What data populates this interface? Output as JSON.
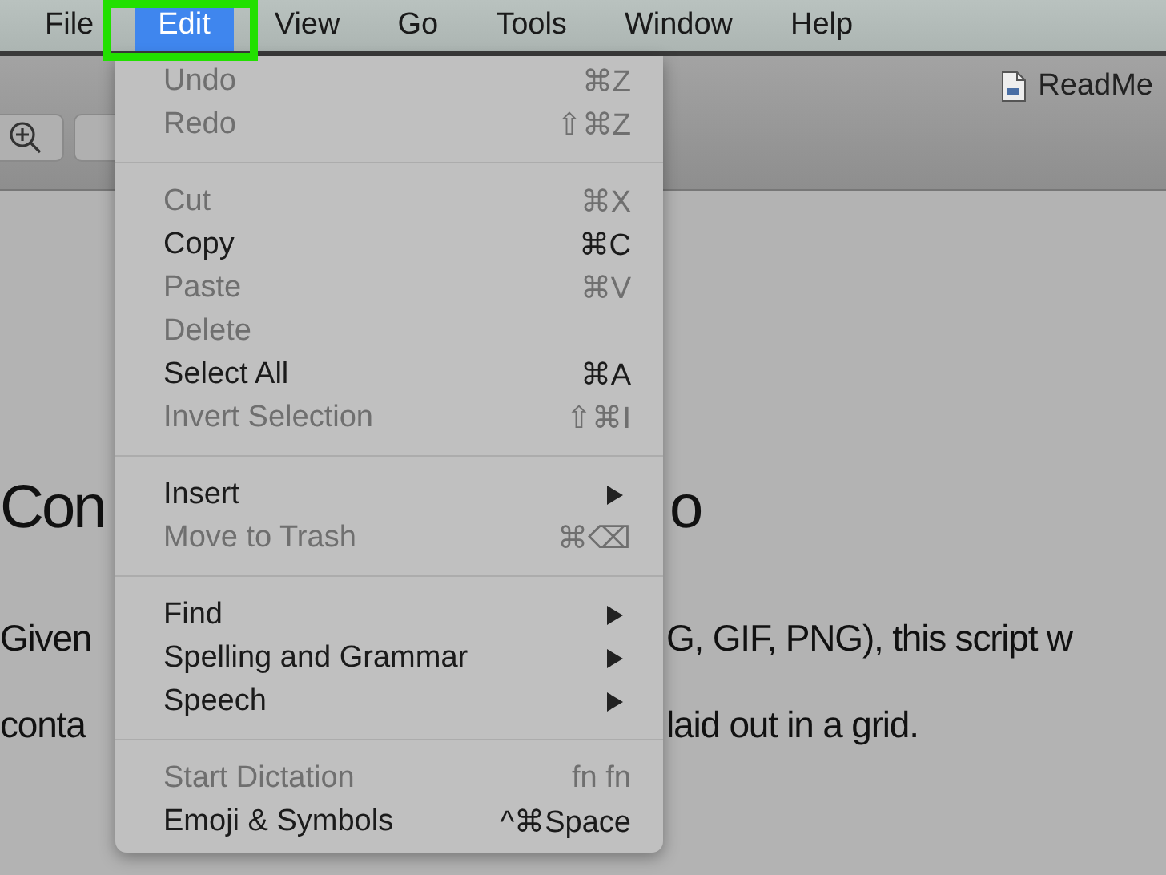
{
  "menu_bar": {
    "items": [
      {
        "label": "File",
        "selected": false,
        "outlined": false
      },
      {
        "label": "Edit",
        "selected": true,
        "outlined": true
      },
      {
        "label": "View",
        "selected": false,
        "outlined": false
      },
      {
        "label": "Go",
        "selected": false,
        "outlined": false
      },
      {
        "label": "Tools",
        "selected": false,
        "outlined": false
      },
      {
        "label": "Window",
        "selected": false,
        "outlined": false
      },
      {
        "label": "Help",
        "selected": false,
        "outlined": false
      }
    ]
  },
  "toolbar": {
    "document_title": "ReadMe"
  },
  "document": {
    "heading_parts": [
      "Con",
      "o"
    ],
    "lines": [
      [
        "Given",
        "G, GIF, PNG), this script w"
      ],
      [
        "conta",
        "laid out in a grid."
      ]
    ]
  },
  "edit_menu": {
    "groups": [
      [
        {
          "kind": "item",
          "label": "Undo",
          "shortcut": "⌘Z",
          "disabled": true
        },
        {
          "kind": "item",
          "label": "Redo",
          "shortcut": "⇧⌘Z",
          "disabled": true
        }
      ],
      [
        {
          "kind": "item",
          "label": "Cut",
          "shortcut": "⌘X",
          "disabled": true
        },
        {
          "kind": "item",
          "label": "Copy",
          "shortcut": "⌘C",
          "disabled": false
        },
        {
          "kind": "item",
          "label": "Paste",
          "shortcut": "⌘V",
          "disabled": true
        },
        {
          "kind": "item",
          "label": "Delete",
          "disabled": true
        },
        {
          "kind": "item",
          "label": "Select All",
          "shortcut": "⌘A",
          "disabled": false
        },
        {
          "kind": "item",
          "label": "Invert Selection",
          "shortcut": "⇧⌘I",
          "disabled": true
        }
      ],
      [
        {
          "kind": "submenu",
          "label": "Insert",
          "disabled": false
        },
        {
          "kind": "item",
          "label": "Move to Trash",
          "shortcut": "⌘⌫",
          "disabled": true
        }
      ],
      [
        {
          "kind": "submenu",
          "label": "Find",
          "disabled": false
        },
        {
          "kind": "submenu",
          "label": "Spelling and Grammar",
          "disabled": false
        },
        {
          "kind": "submenu",
          "label": "Speech",
          "disabled": false
        }
      ],
      [
        {
          "kind": "item",
          "label": "Start Dictation",
          "shortcut": "fn fn",
          "disabled": true
        },
        {
          "kind": "item",
          "label": "Emoji & Symbols",
          "shortcut": "^⌘Space",
          "disabled": false
        }
      ]
    ]
  }
}
